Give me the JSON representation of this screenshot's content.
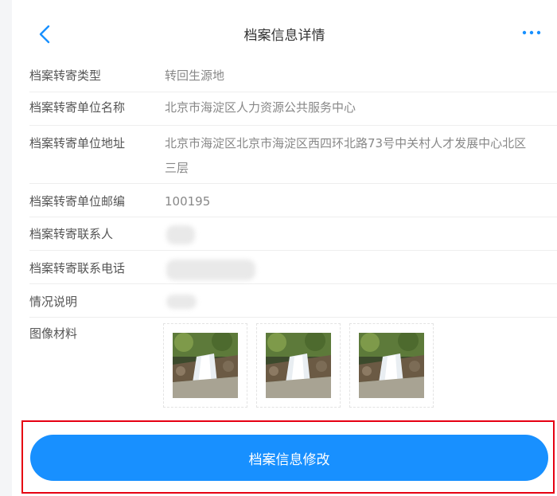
{
  "header": {
    "title": "档案信息详情",
    "back_icon": "chevron-left-icon",
    "more_icon": "more-horizontal-icon",
    "accent_color": "#1890ff"
  },
  "fields": {
    "type": {
      "label": "档案转寄类型",
      "value": "转回生源地"
    },
    "unit": {
      "label": "档案转寄单位名称",
      "value": "北京市海淀区人力资源公共服务中心"
    },
    "address": {
      "label": "档案转寄单位地址",
      "value": "北京市海淀区北京市海淀区西四环北路73号中关村人才发展中心北区三层"
    },
    "postcode": {
      "label": "档案转寄单位邮编",
      "value": "100195"
    },
    "contact": {
      "label": "档案转寄联系人"
    },
    "phone": {
      "label": "档案转寄联系电话"
    },
    "note": {
      "label": "情况说明"
    },
    "images": {
      "label": "图像材料",
      "count": 3
    }
  },
  "footer": {
    "edit_label": "档案信息修改",
    "button_color": "#1890ff",
    "highlight_color": "#e60012"
  }
}
